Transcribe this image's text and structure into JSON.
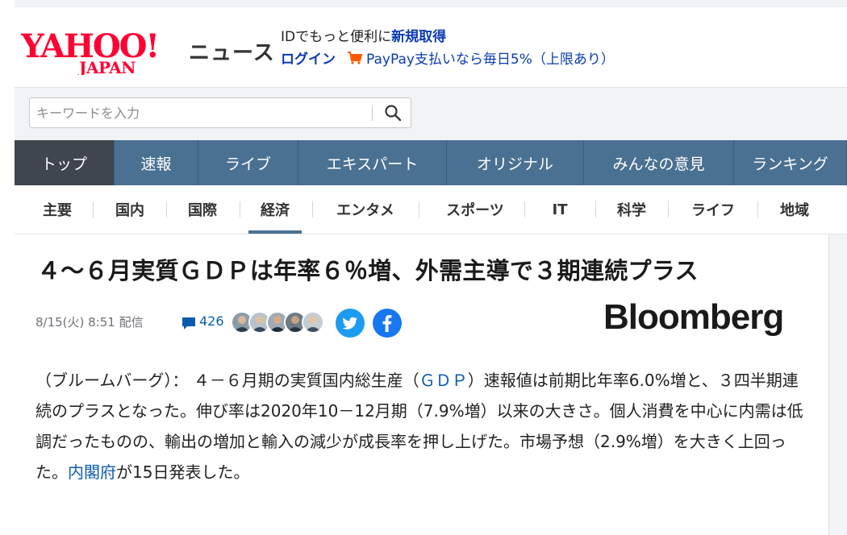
{
  "header": {
    "logo_text": "YAHOO! JAPAN",
    "service_name": "ニュース",
    "promo_line1_prefix": "IDでもっと便利に",
    "promo_line1_link": "新規取得",
    "login_label": "ログイン",
    "payment_promo": "PayPay支払いなら毎日5%（上限あり）",
    "cart_icon": "cart-icon"
  },
  "search": {
    "placeholder": "キーワードを入力",
    "button_icon": "search-icon"
  },
  "global_nav": [
    {
      "label": "トップ",
      "active": true
    },
    {
      "label": "速報",
      "active": false
    },
    {
      "label": "ライブ",
      "active": false
    },
    {
      "label": "エキスパート",
      "active": false
    },
    {
      "label": "オリジナル",
      "active": false
    },
    {
      "label": "みんなの意見",
      "active": false
    },
    {
      "label": "ランキング",
      "active": false
    }
  ],
  "category_nav": [
    {
      "label": "主要",
      "active": false
    },
    {
      "label": "国内",
      "active": false
    },
    {
      "label": "国際",
      "active": false
    },
    {
      "label": "経済",
      "active": true
    },
    {
      "label": "エンタメ",
      "active": false
    },
    {
      "label": "スポーツ",
      "active": false
    },
    {
      "label": "IT",
      "active": false
    },
    {
      "label": "科学",
      "active": false
    },
    {
      "label": "ライフ",
      "active": false
    },
    {
      "label": "地域",
      "active": false
    }
  ],
  "article": {
    "headline": "４～６月実質ＧＤＰは年率６％増、外需主導で３期連続プラス",
    "date": "8/15(火) 8:51 配信",
    "comment_count": "426",
    "source": "Bloomberg",
    "body": {
      "part1": "（ブルームバーグ）： ４－６月期の実質国内総生産（",
      "gdp_link": "ＧＤＰ",
      "part2": "）速報値は前期比年率6.0%増と、３四半期連続のプラスとなった。伸び率は2020年10－12月期（7.9%増）以来の大きさ。個人消費を中心に内需は低調だったものの、輸出の増加と輸入の減少が成長率を押し上げた。市場予想（2.9%増）を大きく上回った。",
      "cabinet_link": "内閣府",
      "part3": "が15日発表した。"
    }
  },
  "colors": {
    "brand_red": "#ff0033",
    "link_blue": "#0b5cad",
    "nav_bg": "#4b7192",
    "nav_active": "#3f4650",
    "twitter": "#1d9bf0",
    "facebook": "#1877f2"
  }
}
